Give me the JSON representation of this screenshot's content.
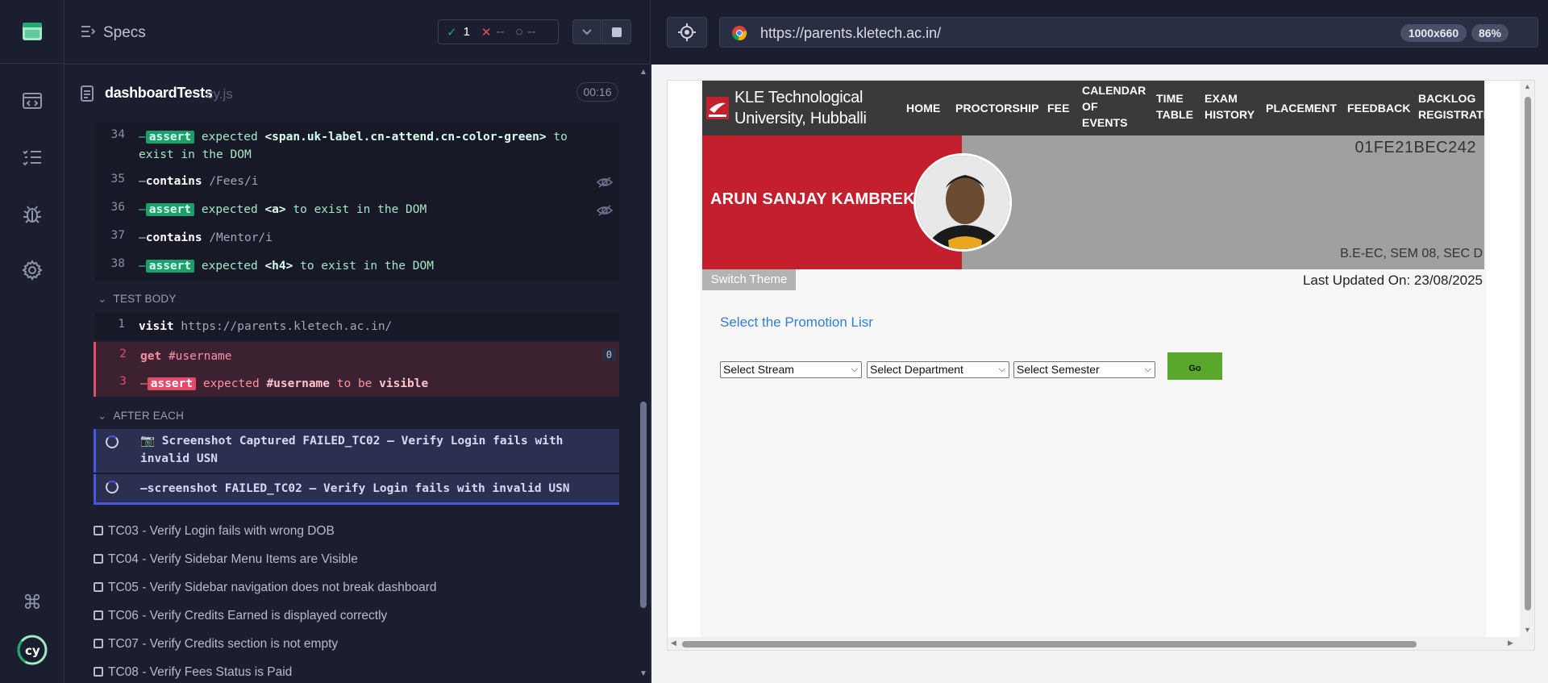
{
  "rail": {
    "icons": [
      "app-logo-icon",
      "specs-icon",
      "runs-icon",
      "debug-icon",
      "settings-icon",
      "keyboard-shortcuts-icon",
      "cypress-logo-icon"
    ]
  },
  "reporter": {
    "header_title": "Specs",
    "stats": {
      "passed": "1",
      "failed": "--",
      "pending": "--"
    },
    "spec_name": "dashboardTests",
    "spec_ext": "cy.js",
    "duration": "00:16",
    "prior_commands": [
      {
        "num": "34",
        "type": "assert",
        "label": "assert",
        "text": "expected",
        "selector": "<span.uk-label.cn-attend.cn-color-green>",
        "rest": "to",
        "rest2": "exist in the DOM"
      },
      {
        "num": "35",
        "type": "contains",
        "label": "contains",
        "arg": "/Fees/i"
      },
      {
        "num": "36",
        "type": "assert",
        "label": "assert",
        "text": "expected",
        "selector": "<a>",
        "rest": "to exist in the DOM"
      },
      {
        "num": "37",
        "type": "contains",
        "label": "contains",
        "arg": "/Mentor/i"
      },
      {
        "num": "38",
        "type": "assert",
        "label": "assert",
        "text": "expected",
        "selector": "<h4>",
        "rest": "to exist in the DOM"
      }
    ],
    "test_body_label": "TEST BODY",
    "body_commands": [
      {
        "num": "1",
        "label": "visit",
        "arg": "https://parents.kletech.ac.in/"
      },
      {
        "num": "2",
        "label": "get",
        "arg": "#username",
        "count": "0"
      },
      {
        "num": "3",
        "label": "assert",
        "pre": "expected",
        "sel": "#username",
        "mid": "to be",
        "post": "visible"
      }
    ],
    "after_each_label": "AFTER EACH",
    "after_commands": [
      {
        "label": "Screenshot Captured",
        "text": "FAILED_TC02 – Verify Login fails with",
        "text2": "invalid USN"
      },
      {
        "label": "screenshot",
        "text": "FAILED_TC02 – Verify Login fails with invalid USN"
      }
    ],
    "tests": [
      "TC03 - Verify Login fails with wrong DOB",
      "TC04 - Verify Sidebar Menu Items are Visible",
      "TC05 - Verify Sidebar navigation does not break dashboard",
      "TC06 - Verify Credits Earned is displayed correctly",
      "TC07 - Verify Credits section is not empty",
      "TC08 - Verify Fees Status is Paid"
    ]
  },
  "aut": {
    "url": "https://parents.kletech.ac.in/",
    "viewport": "1000x660",
    "zoom": "86%",
    "site": {
      "uni_name": "KLE Technological University, Hubballi",
      "nav": [
        "HOME",
        "PROCTORSHIP",
        "FEE",
        "CALENDAR OF EVENTS",
        "TIME TABLE",
        "EXAM HISTORY",
        "PLACEMENT",
        "FEEDBACK",
        "BACKLOG REGISTRATION"
      ],
      "student_name": "ARUN SANJAY KAMBREKAR",
      "usn": "01FE21BEC242",
      "program": "B.E-EC, SEM 08, SEC D",
      "switch_theme": "Switch Theme",
      "last_updated": "Last Updated On: 23/08/2025",
      "promo_title": "Select the Promotion Lisr",
      "selects": [
        "Select Stream",
        "Select Department",
        "Select Semester"
      ],
      "go": "Go"
    }
  },
  "colors": {
    "reporter_bg": "#1b1e2e",
    "passed": "#1fa971",
    "failed": "#e24c6a",
    "banner_red": "#c31f2d",
    "nav_bg": "#3a3a3a",
    "go_green": "#5aa82b",
    "link_blue": "#2f7ed8"
  }
}
